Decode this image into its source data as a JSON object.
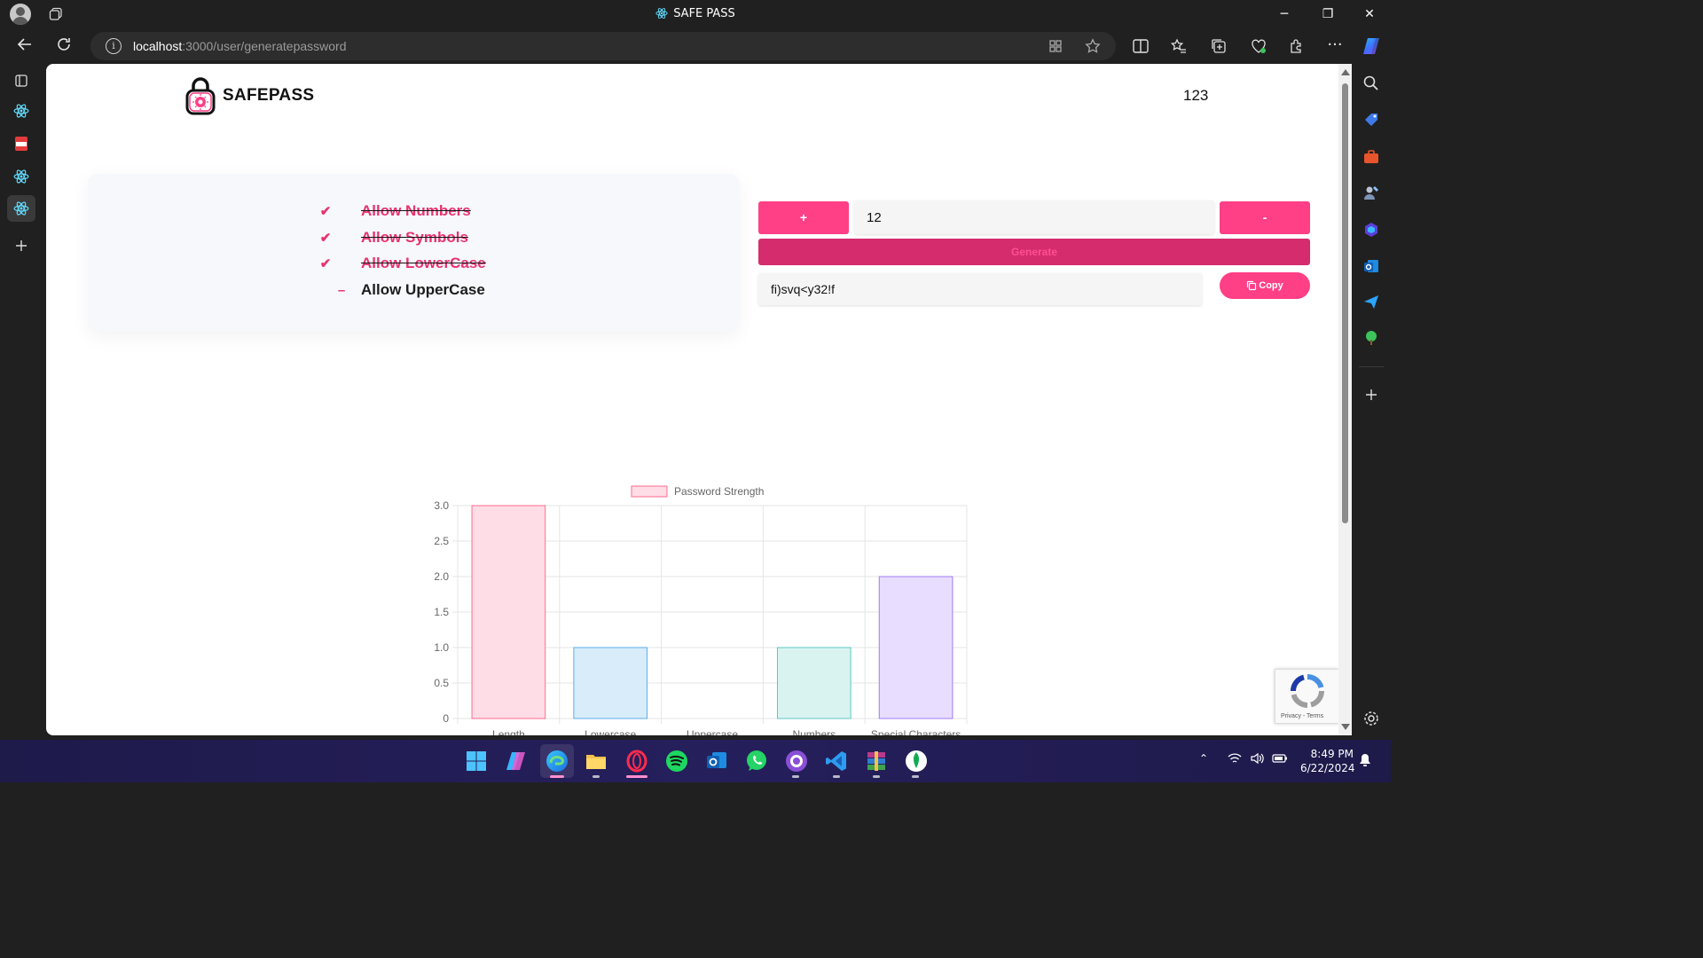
{
  "window": {
    "title": "SAFE PASS",
    "minimize_glyph": "─",
    "maximize_glyph": "❐",
    "close_glyph": "✕"
  },
  "browser": {
    "url_host": "localhost",
    "url_path": ":3000/user/generatepassword"
  },
  "page": {
    "brand": "SAFEPASS",
    "user_count": "123",
    "options": [
      {
        "label": "Allow Numbers",
        "checked": true,
        "mark": "✔"
      },
      {
        "label": "Allow Symbols",
        "checked": true,
        "mark": "✔"
      },
      {
        "label": "Allow LowerCase",
        "checked": true,
        "mark": "✔"
      },
      {
        "label": "Allow UpperCase",
        "checked": false,
        "mark": "–"
      }
    ],
    "length_increment_label": "+",
    "length_value": "12",
    "length_decrement_label": "-",
    "generate_label": "Generate",
    "generated_password": "fi)svq<y32!f",
    "copy_label": "Copy",
    "recaptcha_terms": "Privacy - Terms"
  },
  "chart_data": {
    "type": "bar",
    "legend": [
      "Password Strength"
    ],
    "legend_placement": "top",
    "categories": [
      "Length",
      "Lowercase",
      "Uppercase",
      "Numbers",
      "Special Characters"
    ],
    "series": [
      {
        "name": "Password Strength",
        "values": [
          3,
          1,
          0,
          1,
          2
        ]
      }
    ],
    "bar_fill_colors": [
      "#ffdde6",
      "#d8ecfa",
      "#fff3d6",
      "#d9f3f1",
      "#e8ddff"
    ],
    "bar_stroke_colors": [
      "#ff6b8f",
      "#5aaee8",
      "#ffc94a",
      "#5cc9c1",
      "#a07cf0"
    ],
    "y_ticks": [
      "0",
      "0.5",
      "1.0",
      "1.5",
      "2.0",
      "2.5",
      "3.0"
    ],
    "ylim": [
      0,
      3
    ],
    "grid": true
  },
  "taskbar": {
    "time": "8:49 PM",
    "date": "6/22/2024"
  },
  "colors": {
    "accent": "#ff3f86",
    "generate_bg": "#d42c6d",
    "check": "#e8336f"
  }
}
